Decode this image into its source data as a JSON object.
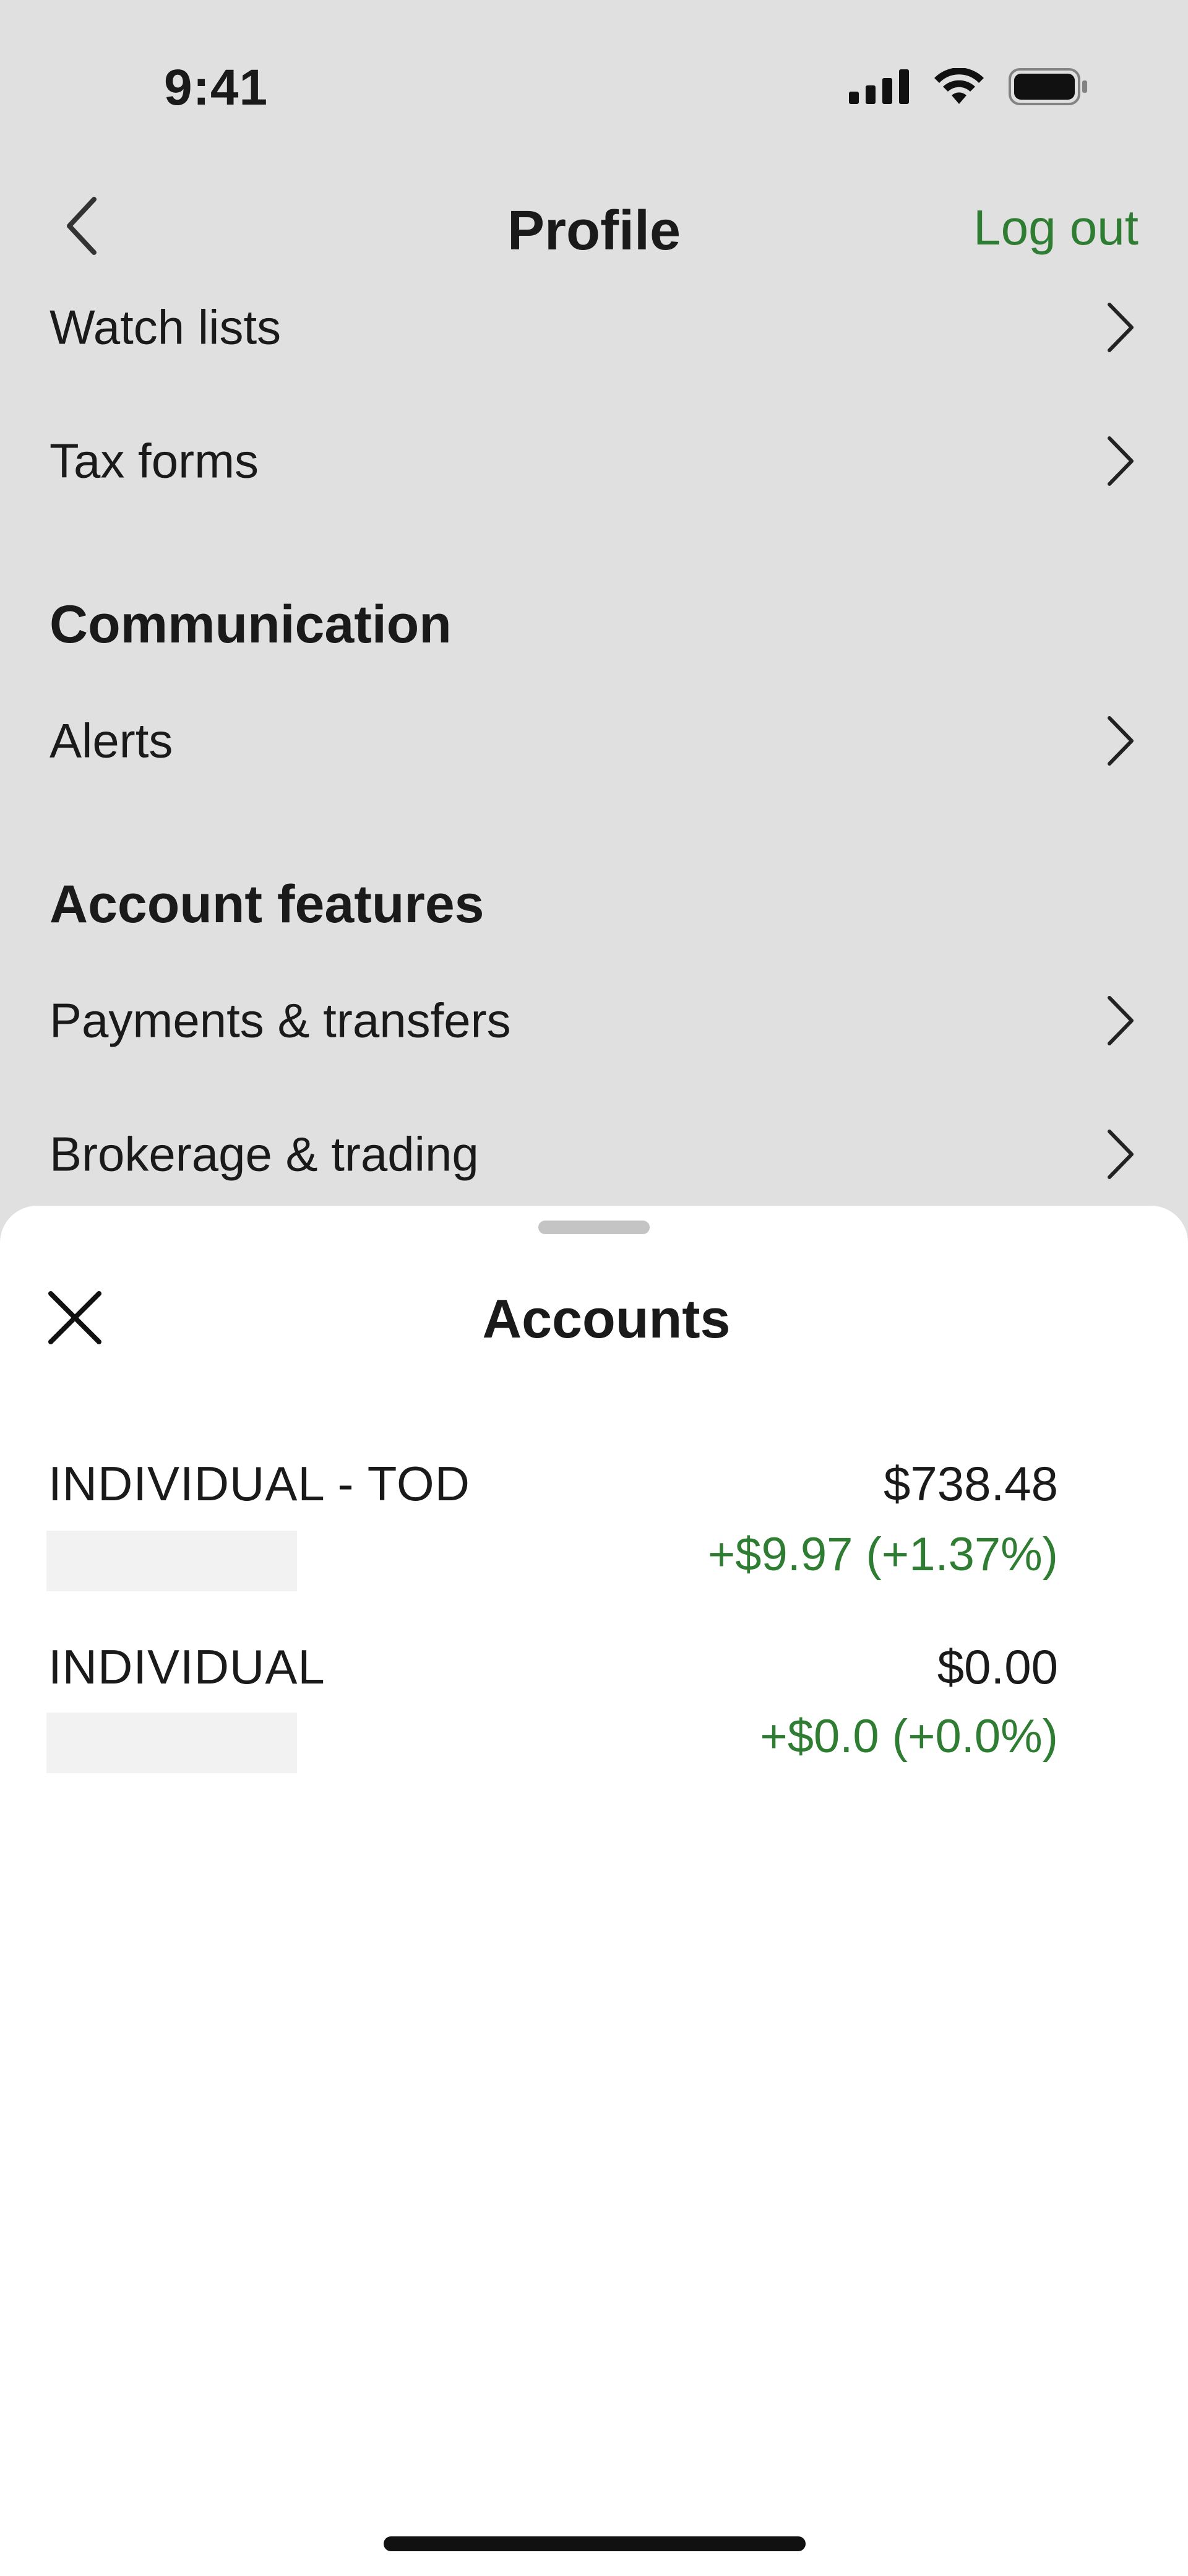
{
  "status_bar": {
    "time": "9:41",
    "icons": [
      "signal-icon",
      "wifi-icon",
      "battery-icon"
    ]
  },
  "nav": {
    "title": "Profile",
    "logout_label": "Log out",
    "back_icon": "chevron-left-icon"
  },
  "profile_list": {
    "items_top": [
      {
        "label": "Watch lists"
      },
      {
        "label": "Tax forms"
      }
    ],
    "communication": {
      "heading": "Communication",
      "items": [
        {
          "label": "Alerts"
        }
      ]
    },
    "account_features": {
      "heading": "Account features",
      "items": [
        {
          "label": "Payments & transfers"
        },
        {
          "label": "Brokerage & trading"
        }
      ]
    }
  },
  "accounts_sheet": {
    "title": "Accounts",
    "close_icon": "close-icon",
    "accounts": [
      {
        "name": "INDIVIDUAL - TOD",
        "balance": "$738.48",
        "change": "+$9.97 (+1.37%)"
      },
      {
        "name": "INDIVIDUAL",
        "balance": "$0.00",
        "change": "+$0.0 (+0.0%)"
      }
    ]
  },
  "colors": {
    "accent_green": "#2e7d32",
    "background_dim": "#e0e0e0",
    "sheet_background": "#ffffff"
  }
}
